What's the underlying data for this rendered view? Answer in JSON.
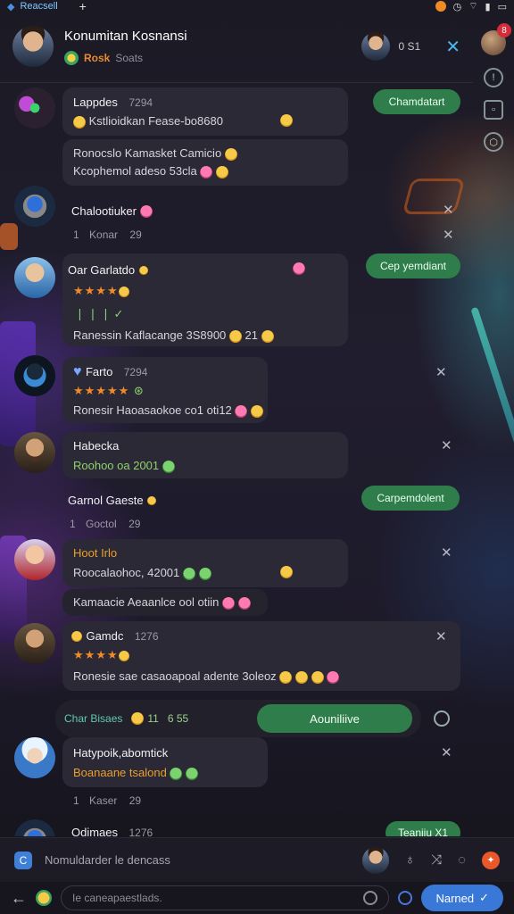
{
  "statusbar": {
    "app_name": "Reacsell"
  },
  "rail": {
    "badge": "8"
  },
  "header": {
    "title": "Konumitan Kosnansi",
    "sub_accent": "Rosk",
    "sub_muted": "Soats",
    "count": "0 S1"
  },
  "messages": [
    {
      "name": "Lappdes",
      "time": "7294",
      "line1": "Kstlioidkan Fease-bo8680",
      "line2": "Ronocslo Kamasket Camicio",
      "line3": "Kcophemol adeso 53cla",
      "pill": "Chamdatart"
    },
    {
      "name": "Chalootiuker",
      "count": "1",
      "meta": "Konar",
      "meta2": "29"
    },
    {
      "name": "Oar Garlatdo",
      "badge": "8",
      "line1": "Ranessin Kaflacange 3S8900",
      "extra": "21",
      "pill": "Cep yemdiant"
    },
    {
      "name": "Farto",
      "time": "7294",
      "line1": "Ronesir Haoasaokoe co1 oti12"
    },
    {
      "name": "Habecka",
      "line1": "Roohoo oa 2001"
    },
    {
      "name": "Garnol Gaeste",
      "count": "1",
      "meta": "Goctol",
      "meta2": "29",
      "pill": "Carpemdolent"
    },
    {
      "name": "Hoot Irlo",
      "line1": "Roocalaohoc, 42001",
      "line2": "Kamaacie Aeaanlce ool otiin"
    },
    {
      "name": "Gamdc",
      "time": "1276",
      "line1": "Ronesie sae casaoapoal adente 3oleoz"
    },
    {
      "name": "Hatypoik,abomtick",
      "line1": "Boanaane tsalond",
      "count": "1",
      "meta": "Kaser",
      "meta2": "29"
    },
    {
      "name": "Odimaes",
      "time": "1276",
      "pill": "Teaniiu X1"
    }
  ],
  "actionbar": {
    "label": "Char Bisaes",
    "chip1": "11",
    "chip2": "6 55",
    "button": "Aouniliive"
  },
  "compose": {
    "placeholder": "Nomuldarder le dencass"
  },
  "input": {
    "placeholder": "Ie caneapaestlads.",
    "send": "Narned"
  }
}
